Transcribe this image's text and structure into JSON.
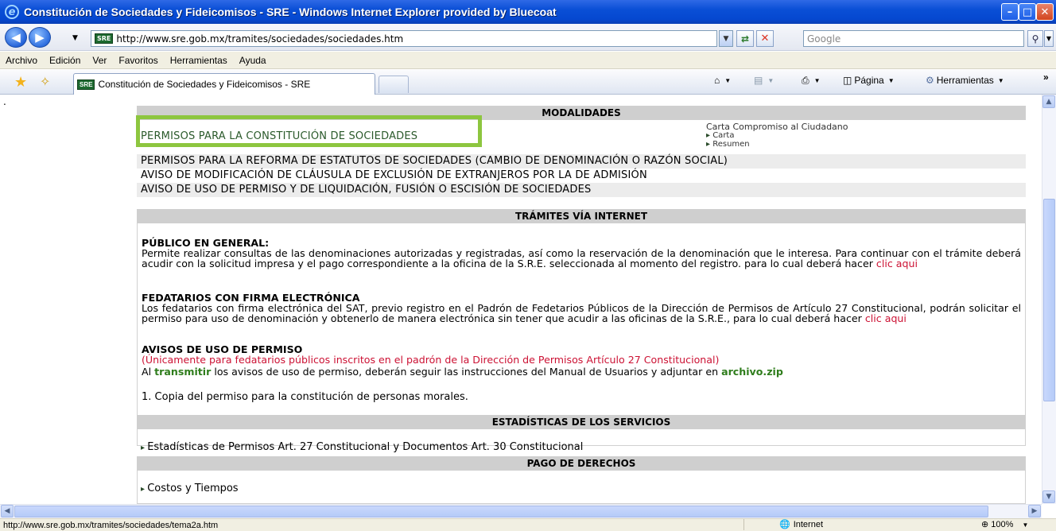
{
  "window": {
    "title": "Constitución de Sociedades y Fideicomisos - SRE - Windows Internet Explorer provided by Bluecoat"
  },
  "address": {
    "url": "http://www.sre.gob.mx/tramites/sociedades/sociedades.htm",
    "search_placeholder": "Google",
    "site_badge": "SRE"
  },
  "menu": [
    "Archivo",
    "Edición",
    "Ver",
    "Favoritos",
    "Herramientas",
    "Ayuda"
  ],
  "tab": {
    "title": "Constitución de Sociedades y Fideicomisos - SRE"
  },
  "commands": {
    "page": "Página",
    "tools": "Herramientas"
  },
  "page": {
    "dot": ".",
    "modalidades": {
      "header": "MODALIDADES",
      "items": [
        "PERMISOS PARA LA CONSTITUCIÓN DE SOCIEDADES",
        "PERMISOS PARA LA REFORMA DE ESTATUTOS DE SOCIEDADES (CAMBIO DE DENOMINACIÓN O RAZÓN SOCIAL)",
        "AVISO DE MODIFICACIÓN DE CLÁUSULA DE EXCLUSIÓN DE EXTRANJEROS POR LA DE ADMISIÓN",
        "AVISO DE USO DE PERMISO Y DE LIQUIDACIÓN, FUSIÓN O ESCISIÓN DE SOCIEDADES"
      ],
      "carta": {
        "title": "Carta Compromiso al Ciudadano",
        "link1": "Carta",
        "link2": "Resumen"
      }
    },
    "tramites": {
      "header": "TRÁMITES VÍA INTERNET",
      "publico": {
        "title": "PÚBLICO EN GENERAL:",
        "text": "Permite realizar consultas de las denominaciones autorizadas y registradas, así como la reservación de la denominación que le interesa. Para continuar con el trámite deberá acudir con la solicitud impresa y el pago correspondiente a la oficina de la S.R.E. seleccionada al momento del registro. para lo cual deberá hacer",
        "link": "clic aqui"
      },
      "fedatarios": {
        "title": "FEDATARIOS CON FIRMA ELECTRÓNICA",
        "text": "Los fedatarios con firma electrónica del SAT, previo registro en el Padrón de Fedetarios Públicos de la Dirección de Permisos de Artículo 27 Constitucional, podrán solicitar el permiso para uso de denominación y obtenerlo de manera electrónica sin tener que acudir a las oficinas de la S.R.E., para lo cual deberá hacer",
        "link": "clic aqui"
      },
      "avisos": {
        "title": "AVISOS DE USO DE PERMISO",
        "note": "(Únicamente para fedatarios públicos inscritos en el padrón de la Dirección de Permisos Artículo 27 Constitucional)",
        "pre": "Al",
        "transmitir": "transmitir",
        "mid": "los avisos de uso de permiso, deberán seguir las instrucciones del Manual de Usuarios y adjuntar en",
        "zip": "archivo.zip",
        "item1": "1. Copia del permiso para la constitución de personas morales."
      }
    },
    "estadisticas": {
      "header": "ESTADÍSTICAS DE LOS SERVICIOS",
      "link": "Estadísticas de Permisos Art. 27 Constitucional y Documentos Art. 30 Constitucional"
    },
    "pago": {
      "header": "PAGO DE DERECHOS",
      "link": "Costos y Tiempos"
    }
  },
  "status": {
    "url": "http://www.sre.gob.mx/tramites/sociedades/tema2a.htm",
    "zone": "Internet",
    "zoom": "100%"
  },
  "colors": {
    "title_bar": "#0548d0",
    "highlight": "#8dc63f",
    "link_red": "#cc1133",
    "link_green": "#2f7d1c"
  }
}
